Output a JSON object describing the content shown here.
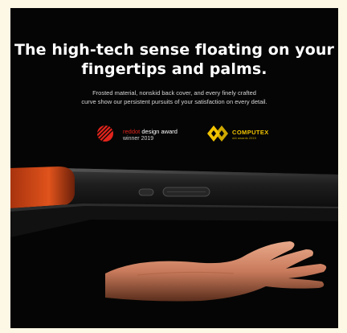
{
  "headline": {
    "line1": "The high-tech sense floating on your",
    "line2": "fingertips and palms."
  },
  "subheadline": {
    "line1": "Frosted material, nonskid back cover, and every finely crafted",
    "line2": "curve show our persistent pursuits of your satisfaction on every detail."
  },
  "awards": {
    "reddot": {
      "red_part": "reddot",
      "rest": " design award",
      "year_line": "winner 2019"
    },
    "computex": {
      "name": "COMPUTEX",
      "sub": "d&i awards 2019"
    }
  },
  "colors": {
    "background": "#050505",
    "page": "#fdf8e6",
    "accent_orange": "#e0531c",
    "reddot_red": "#e2241c",
    "computex_gold": "#f2c400"
  },
  "icons": [
    "reddot-logo-icon",
    "computex-logo-icon"
  ]
}
